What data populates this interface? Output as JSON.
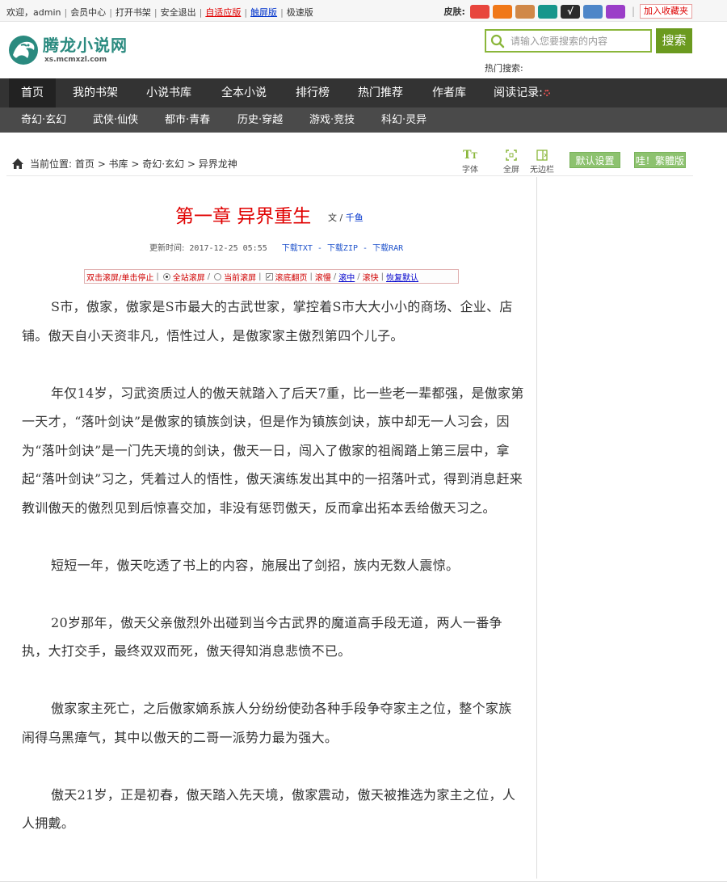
{
  "topbar": {
    "welcome": "欢迎，admin",
    "links": [
      "会员中心",
      "打开书架",
      "安全退出"
    ],
    "link_adaptive": "自适应版",
    "link_touch": "触屏版",
    "link_fast": "极速版",
    "skin_label": "皮肤:",
    "skins": [
      {
        "color": "#e8453c",
        "mark": ""
      },
      {
        "color": "#f07818",
        "mark": ""
      },
      {
        "color": "#d08848",
        "mark": ""
      },
      {
        "color": "#17968c",
        "mark": ""
      },
      {
        "color": "#2b2b2b",
        "mark": "√"
      },
      {
        "color": "#4e86c8",
        "mark": ""
      },
      {
        "color": "#9b3ec8",
        "mark": ""
      }
    ],
    "favorite": "加入收藏夹"
  },
  "header": {
    "logo_title": "腾龙小说网",
    "logo_sub": "xs.mcmxzl.com",
    "search_placeholder": "请输入您要搜索的内容",
    "search_button": "搜索",
    "hot_search": "热门搜索:"
  },
  "nav": {
    "main": [
      "首页",
      "我的书架",
      "小说书库",
      "全本小说",
      "排行榜",
      "热门推荐",
      "作者库",
      "阅读记录:"
    ],
    "categories": [
      "奇幻·玄幻",
      "武侠·仙侠",
      "都市·青春",
      "历史·穿越",
      "游戏·竞技",
      "科幻·灵异"
    ]
  },
  "breadcrumb": {
    "label": "当前位置:",
    "path": "首页 > 书库 > 奇幻·玄幻 > 异界龙神"
  },
  "tools": {
    "font": "字体",
    "fullscreen": "全屏",
    "no_sidebar": "无边栏",
    "default_settings": "默认设置",
    "traditional": "哇！繁體版"
  },
  "chapter": {
    "title": "第一章 异界重生",
    "author_prefix": "文 /",
    "author": "千鱼",
    "updated_label": "更新时间:",
    "updated": "2017-12-25 05:55",
    "downloads": [
      "下载TXT",
      "下载ZIP",
      "下载RAR"
    ]
  },
  "scroll_controls": {
    "hint": "双击滚屏/单击停止",
    "all_scroll": "全站滚屏",
    "current_scroll": "当前滚屏",
    "bottom_flip": "滚底翻页",
    "slow": "滚慢",
    "medium": "滚中",
    "fast": "滚快",
    "reset": "恢复默认"
  },
  "paragraphs": [
    "S市，傲家，傲家是S市最大的古武世家，掌控着S市大大小小的商场、企业、店铺。傲天自小天资非凡，悟性过人，是傲家家主傲烈第四个儿子。",
    "年仅14岁，习武资质过人的傲天就踏入了后天7重，比一些老一辈都强，是傲家第一天才，“落叶剑诀”是傲家的镇族剑诀，但是作为镇族剑诀，族中却无一人习会，因为“落叶剑诀”是一门先天境的剑诀，傲天一日，闯入了傲家的祖阁踏上第三层中，拿起“落叶剑诀”习之，凭着过人的悟性，傲天演练发出其中的一招落叶式，得到消息赶来教训傲天的傲烈见到后惊喜交加，非没有惩罚傲天，反而拿出拓本丢给傲天习之。",
    "短短一年，傲天吃透了书上的内容，施展出了剑招，族内无数人震惊。",
    "20岁那年，傲天父亲傲烈外出碰到当今古武界的魔道高手段无道，两人一番争执，大打交手，最终双双而死，傲天得知消息悲愤不已。",
    "傲家家主死亡，之后傲家嫡系族人分纷纷使劲各种手段争夺家主之位，整个家族闹得乌黑瘴气，其中以傲天的二哥一派势力最为强大。",
    "傲天21岁，正是初春，傲天踏入先天境，傲家震动，傲天被推选为家主之位，人人拥戴。"
  ]
}
